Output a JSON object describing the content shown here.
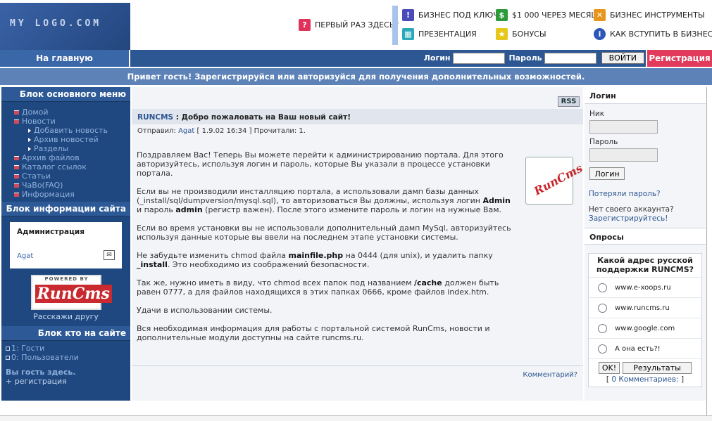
{
  "header": {
    "logo_text": "MY LOGO.COM",
    "items": [
      {
        "label": "ПЕРВЫЙ РАЗ ЗДЕСЬ?",
        "icon": "question-icon",
        "color": "#e0335a",
        "glyph": "?"
      },
      {
        "label": "БИЗНЕС ПОД КЛЮЧ",
        "icon": "exclamation-icon",
        "color": "#4a4ab8",
        "glyph": "!"
      },
      {
        "label": "$1 000 ЧЕРЕЗ МЕСЯЦ",
        "icon": "dollar-icon",
        "color": "#2d9a3a",
        "glyph": "$"
      },
      {
        "label": "БИЗНЕС ИНСТРУМЕНТЫ",
        "icon": "tools-icon",
        "color": "#e8951e",
        "glyph": "✕"
      },
      {
        "label": "ПРЕЗЕНТАЦИЯ",
        "icon": "film-icon",
        "color": "#2aa9b8",
        "glyph": "▦"
      },
      {
        "label": "БОНУСЫ",
        "icon": "bonus-icon",
        "color": "#e6c81a",
        "glyph": "★"
      },
      {
        "label": "КАК ВСТУПИТЬ В БИЗНЕС",
        "icon": "info-icon",
        "color": "#2c57b8",
        "glyph": "i"
      }
    ]
  },
  "nav": {
    "home": "На главную",
    "login_label": "Логин",
    "password_label": "Пароль",
    "login_button": "ВОЙТИ",
    "register": "Регистрация"
  },
  "welcome": "Привет гость! Зарегистрируйся или авторизуйся для получения дополнительных возможностей.",
  "left": {
    "main_menu_title": "Блок основного меню",
    "menu": [
      {
        "label": "Домой",
        "sub": false
      },
      {
        "label": "Новости",
        "sub": false
      },
      {
        "label": "Добавить новость",
        "sub": true
      },
      {
        "label": "Архив новостей",
        "sub": true
      },
      {
        "label": "Разделы",
        "sub": true
      },
      {
        "label": "Архив файлов",
        "sub": false
      },
      {
        "label": "Каталог ссылок",
        "sub": false
      },
      {
        "label": "Статьи",
        "sub": false
      },
      {
        "label": "ЧаВо(FAQ)",
        "sub": false
      },
      {
        "label": "Информация",
        "sub": false
      }
    ],
    "info_title": "Блок информации сайта",
    "admin_title": "Администрация",
    "admin_name": "Agat",
    "powered_by": "POWERED BY",
    "runcms": "RunCms",
    "tell_friend": "Расскажи другу",
    "online_title": "Блок кто на сайте",
    "online": [
      "1: Гости",
      "0: Пользователи"
    ],
    "guest_here": "Вы гость здесь.",
    "guest_register": "+ регистрация"
  },
  "news": {
    "rss": "RSS",
    "title_prefix": "RUNCMS",
    "title": ": Добро пожаловать на Ваш новый сайт!",
    "meta_prefix": "Отправил:",
    "author": "Agat",
    "meta_rest": "[ 1.9.02 16:34 ] Прочитали: 1.",
    "icon_text": "RunCms",
    "comments": "Комментарий?"
  },
  "right": {
    "login_title": "Логин",
    "nick_label": "Ник",
    "password_label": "Пароль",
    "login_button": "Логин",
    "lost_password": "Потеряли пароль?",
    "no_account": "Нет своего аккаунта?",
    "register_link": "Зарегистрируйтесь!",
    "polls_title": "Опросы",
    "poll_question": "Какой адрес русской поддержки RUNCMS?",
    "poll_options": [
      "www.e-xoops.ru",
      "www.runcms.ru",
      "www.google.com",
      "А она есть?!"
    ],
    "ok_button": "OK!",
    "results_button": "Результаты",
    "poll_comments_open": "[",
    "poll_comments_count": "0",
    "poll_comments_label": "Комментариев:",
    "poll_comments_close": "]"
  }
}
